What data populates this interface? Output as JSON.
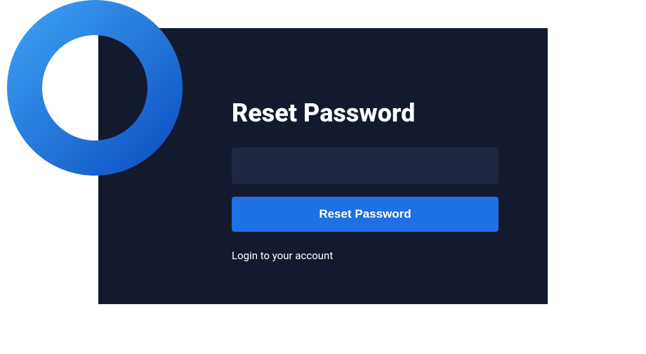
{
  "heading": "Reset Password",
  "form": {
    "email_value": "",
    "email_placeholder": "",
    "submit_label": "Reset Password"
  },
  "login_link": "Login to your account",
  "colors": {
    "card_bg": "#131a2e",
    "input_bg": "#1f2740",
    "button_bg": "#1f6fe5",
    "logo_gradient_start": "#3a9cf0",
    "logo_gradient_end": "#1054c5"
  }
}
